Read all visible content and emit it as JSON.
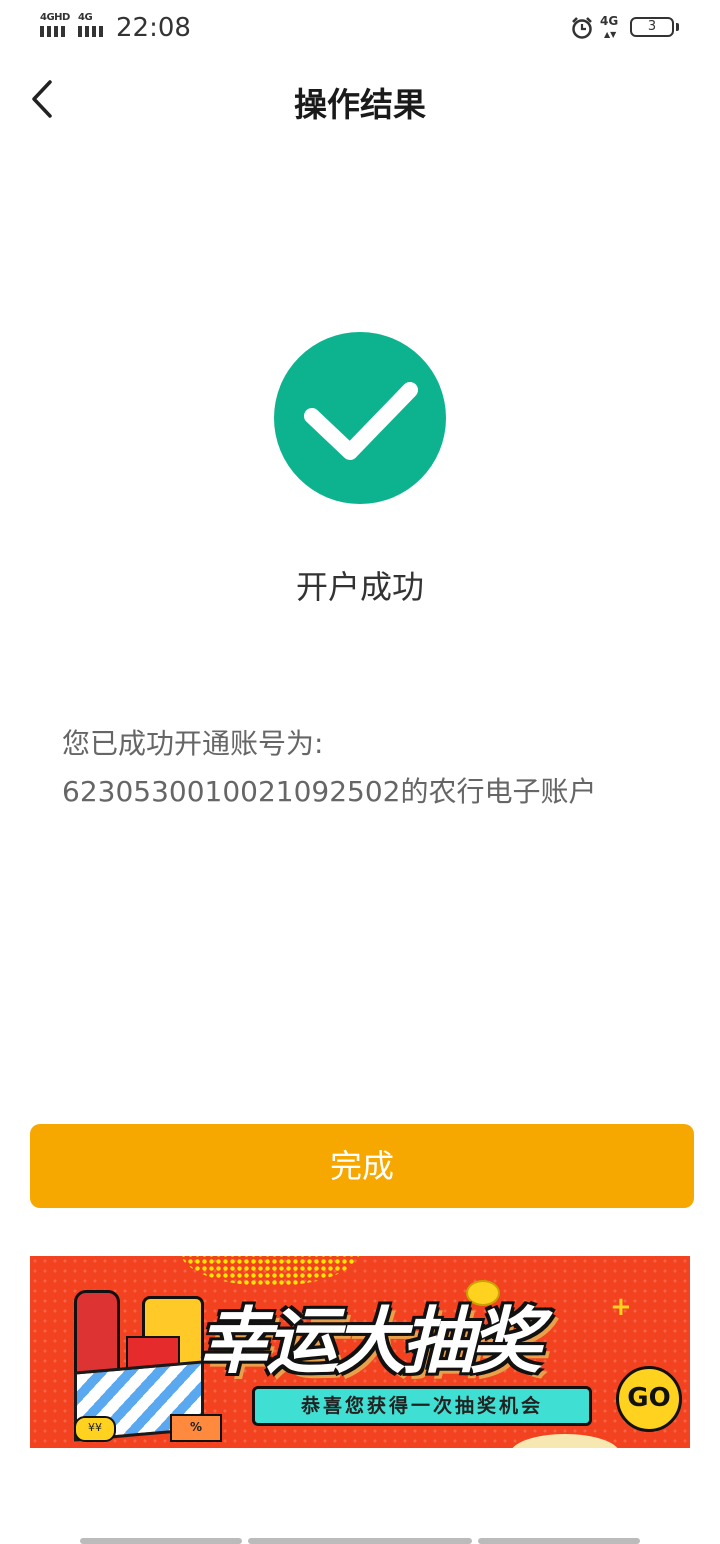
{
  "status_bar": {
    "sim1_label": "4GHD",
    "sim2_label": "4G",
    "time": "22:08",
    "network_label": "4G",
    "battery_level": "3"
  },
  "nav": {
    "back_icon": "chevron-left-icon",
    "title": "操作结果"
  },
  "result": {
    "icon": "check-circle-icon",
    "icon_color": "#0db28f",
    "status_text": "开户成功",
    "message_line1": "您已成功开通账号为:",
    "message_line2": "6230530010021092502的农行电子账户"
  },
  "done_button": {
    "label": "完成",
    "color": "#f7a800"
  },
  "banner": {
    "title": "幸运大抽奖",
    "subtitle": "恭喜您获得一次抽奖机会",
    "go_label": "GO",
    "coins_label": "¥¥",
    "ticket_label": "%",
    "background_color": "#f3421f"
  }
}
